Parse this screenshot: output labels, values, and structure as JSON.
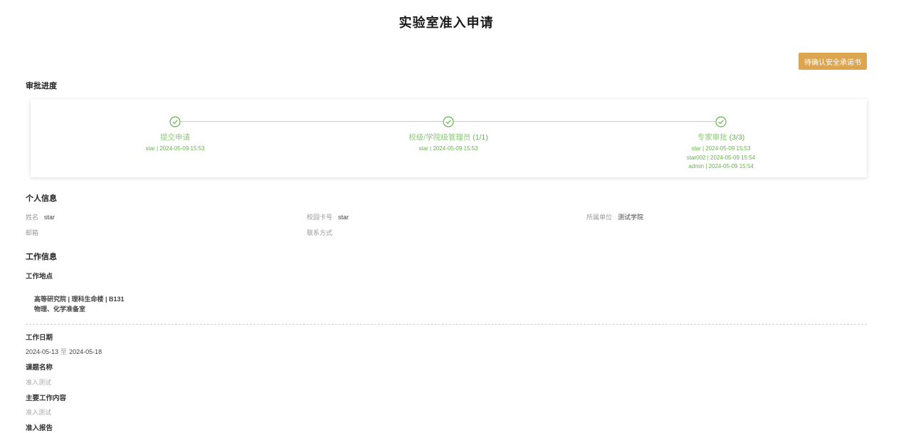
{
  "page": {
    "title": "实验室准入申请"
  },
  "header": {
    "action_button": "待确认安全承诺书"
  },
  "approval": {
    "section_title": "审批进度",
    "steps": [
      {
        "title": "提交申请",
        "count": "",
        "records": [
          "star | 2024-05-09 15:53"
        ]
      },
      {
        "title": "校级/学院级管理员",
        "count": "(1/1)",
        "records": [
          "star | 2024-05-09 15:53"
        ]
      },
      {
        "title": "专家审批",
        "count": "(3/3)",
        "records": [
          "star | 2024-05-09 15:53",
          "star002 | 2024-05-09 15:54",
          "admin | 2024-05-09 15:54"
        ]
      }
    ],
    "colors": {
      "done": "#67b34e",
      "line": "#c9c9c9"
    }
  },
  "personal": {
    "section_title": "个人信息",
    "name_label": "姓名",
    "name_value": "star",
    "card_label": "校园卡号",
    "card_value": "star",
    "unit_label": "所属单位",
    "unit_value": "测试学院",
    "email_label": "邮箱",
    "email_value": "",
    "contact_label": "联系方式",
    "contact_value": ""
  },
  "work": {
    "section_title": "工作信息",
    "location_label": "工作地点",
    "location_line1": "高等研究院 | 理科生命楼 | B131",
    "location_line2": "物理、化学准备室",
    "date_label": "工作日期",
    "date_start": "2024-05-13",
    "date_sep": "至",
    "date_end": "2024-05-18",
    "topic_label": "课题名称",
    "topic_value": "准入测试",
    "content_label": "主要工作内容",
    "content_value": "准入测试",
    "report_label": "准入报告"
  },
  "accent_colors": {
    "button": "#dca550"
  }
}
